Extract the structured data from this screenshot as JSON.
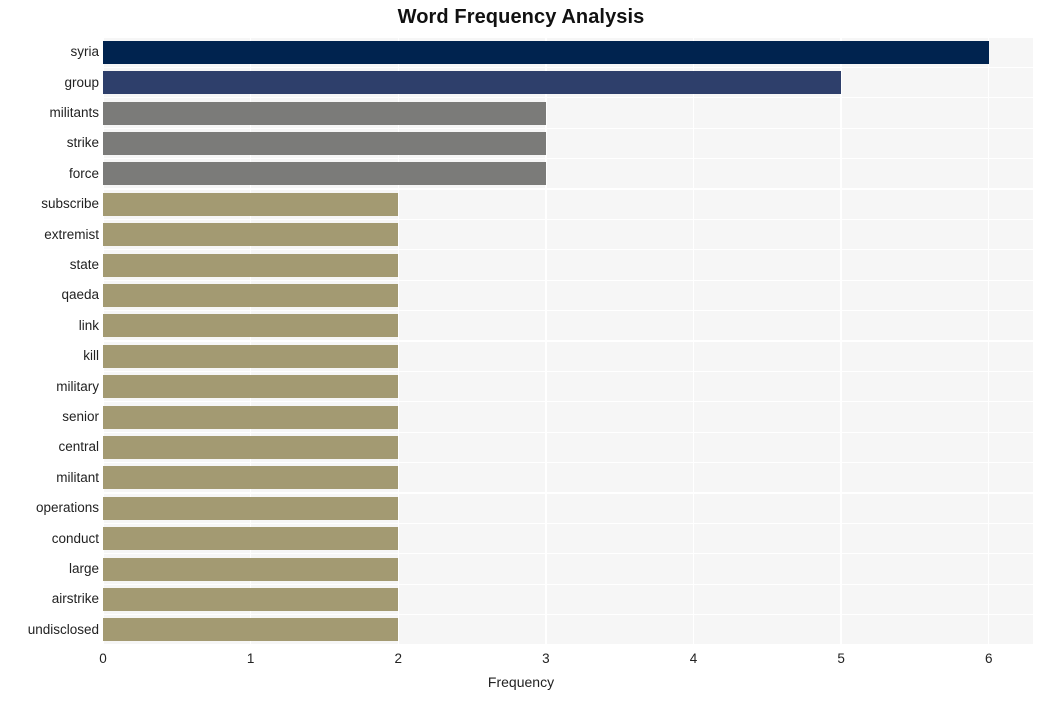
{
  "chart_data": {
    "type": "bar",
    "orientation": "horizontal",
    "title": "Word Frequency Analysis",
    "xlabel": "Frequency",
    "ylabel": "",
    "xlim": [
      0,
      6.3
    ],
    "xticks": [
      0,
      1,
      2,
      3,
      4,
      5,
      6
    ],
    "xtick_labels": [
      "0",
      "1",
      "2",
      "3",
      "4",
      "5",
      "6"
    ],
    "grid": true,
    "legend": null,
    "categories": [
      "syria",
      "group",
      "militants",
      "strike",
      "force",
      "subscribe",
      "extremist",
      "state",
      "qaeda",
      "link",
      "kill",
      "military",
      "senior",
      "central",
      "militant",
      "operations",
      "conduct",
      "large",
      "airstrike",
      "undisclosed"
    ],
    "values": [
      6,
      5,
      3,
      3,
      3,
      2,
      2,
      2,
      2,
      2,
      2,
      2,
      2,
      2,
      2,
      2,
      2,
      2,
      2,
      2
    ],
    "bar_colors": [
      "#00234f",
      "#2e3f6b",
      "#7b7b79",
      "#7b7b79",
      "#7b7b79",
      "#a39a72",
      "#a39a72",
      "#a39a72",
      "#a39a72",
      "#a39a72",
      "#a39a72",
      "#a39a72",
      "#a39a72",
      "#a39a72",
      "#a39a72",
      "#a39a72",
      "#a39a72",
      "#a39a72",
      "#a39a72",
      "#a39a72"
    ]
  },
  "style": {
    "plot_background": "#f6f6f6",
    "figure_background": "#ffffff",
    "gridline_color": "#ffffff",
    "text_color": "#222222",
    "title_color": "#111111"
  }
}
